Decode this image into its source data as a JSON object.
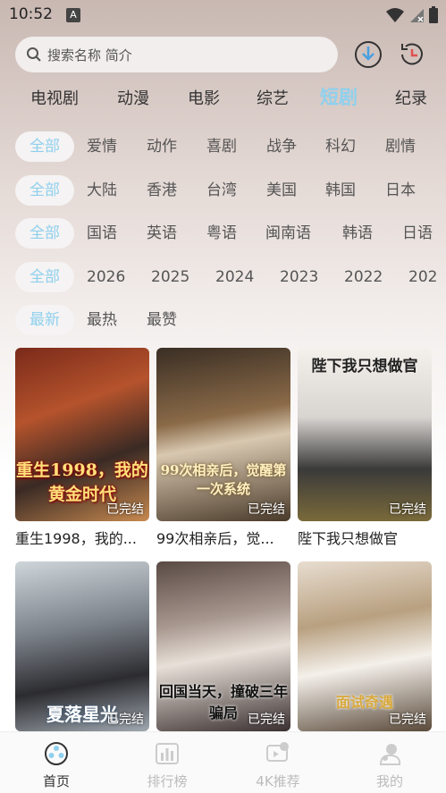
{
  "status": {
    "time": "10:52",
    "notif": "A"
  },
  "search": {
    "placeholder": "搜索名称 简介"
  },
  "categories": [
    "电视剧",
    "动漫",
    "电影",
    "综艺",
    "短剧",
    "纪录"
  ],
  "filters": {
    "genre": [
      "全部",
      "爱情",
      "动作",
      "喜剧",
      "战争",
      "科幻",
      "剧情"
    ],
    "region": [
      "全部",
      "大陆",
      "香港",
      "台湾",
      "美国",
      "韩国",
      "日本"
    ],
    "language": [
      "全部",
      "国语",
      "英语",
      "粤语",
      "闽南语",
      "韩语",
      "日语"
    ],
    "year": [
      "全部",
      "2026",
      "2025",
      "2024",
      "2023",
      "2022",
      "202"
    ],
    "sort": [
      "最新",
      "最热",
      "最赞"
    ]
  },
  "cards": [
    {
      "title": "重生1998，我的...",
      "poster_text": "重生1998，我的黄金时代",
      "status": "已完结"
    },
    {
      "title": "99次相亲后，觉...",
      "poster_text": "99次相亲后，觉醒第一次系统",
      "status": "已完结"
    },
    {
      "title": "陛下我只想做官",
      "poster_text": "陛下我只想做官",
      "status": "已完结"
    },
    {
      "title": "",
      "poster_text": "夏落星光",
      "status": "已完结"
    },
    {
      "title": "",
      "poster_text": "回国当天，撞破三年骗局",
      "status": "已完结"
    },
    {
      "title": "",
      "poster_text": "面试奇遇",
      "status": "已完结"
    }
  ],
  "nav": [
    "首页",
    "排行榜",
    "4K推荐",
    "我的"
  ],
  "colors": {
    "accent": "#8fd0ee",
    "inactive": "#bbbbbb"
  }
}
